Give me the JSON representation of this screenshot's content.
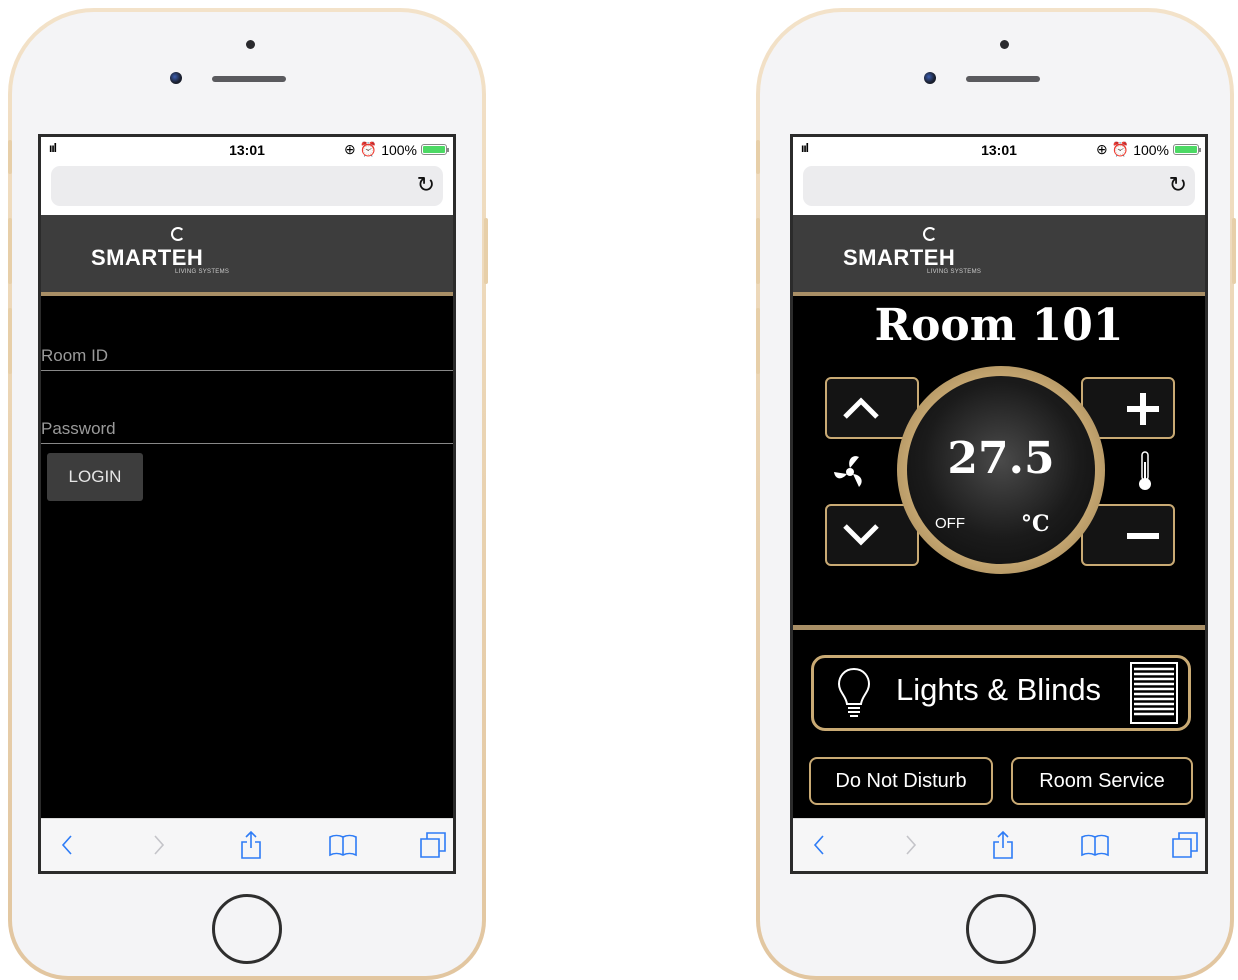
{
  "status_bar": {
    "time": "13:01",
    "battery": "100%",
    "signal": "ııl"
  },
  "login": {
    "room_id_placeholder": "Room ID",
    "password_placeholder": "Password",
    "login_label": "LOGIN"
  },
  "brand": {
    "name": "SMARTEH",
    "tagline": "LIVING SYSTEMS"
  },
  "room": {
    "title": "Room 101",
    "temperature": "27.5",
    "mode": "OFF",
    "unit": "°C",
    "lights_blinds_label": "Lights & Blinds",
    "dnd_label": "Do Not Disturb",
    "room_service_label": "Room Service"
  },
  "colors": {
    "gold": "#c9aa74",
    "brand_bar": "#3d3d3d",
    "accent": "#2e7cf6",
    "battery": "#4cd964"
  },
  "toolbar_icons": [
    "back-icon",
    "forward-icon",
    "share-icon",
    "bookmarks-icon",
    "tabs-icon"
  ]
}
